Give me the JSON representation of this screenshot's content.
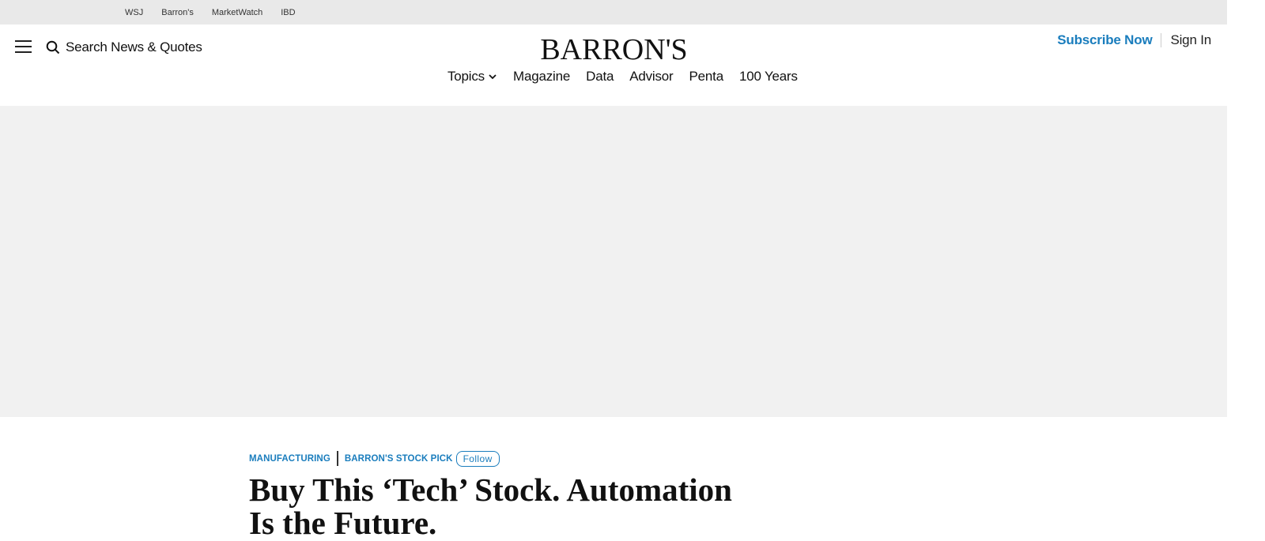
{
  "topbar": {
    "links": [
      "WSJ",
      "Barron's",
      "MarketWatch",
      "IBD"
    ]
  },
  "header": {
    "search_label": "Search News & Quotes",
    "logo_text": "BARRON'S",
    "subscribe_label": "Subscribe Now",
    "signin_label": "Sign In"
  },
  "nav": {
    "items": [
      "Topics",
      "Magazine",
      "Data",
      "Advisor",
      "Penta",
      "100 Years"
    ]
  },
  "article": {
    "tags": [
      "MANUFACTURING",
      "BARRON'S STOCK PICK"
    ],
    "follow_label": "Follow",
    "headline": "Buy This ‘Tech’ Stock. Automation Is the Future."
  },
  "colors": {
    "accent": "#1a7dbd",
    "topbar_bg": "#e9e9e9",
    "ad_bg": "#f1f1f1"
  },
  "icons": [
    "hamburger-menu-icon",
    "search-icon",
    "chevron-down-icon"
  ]
}
